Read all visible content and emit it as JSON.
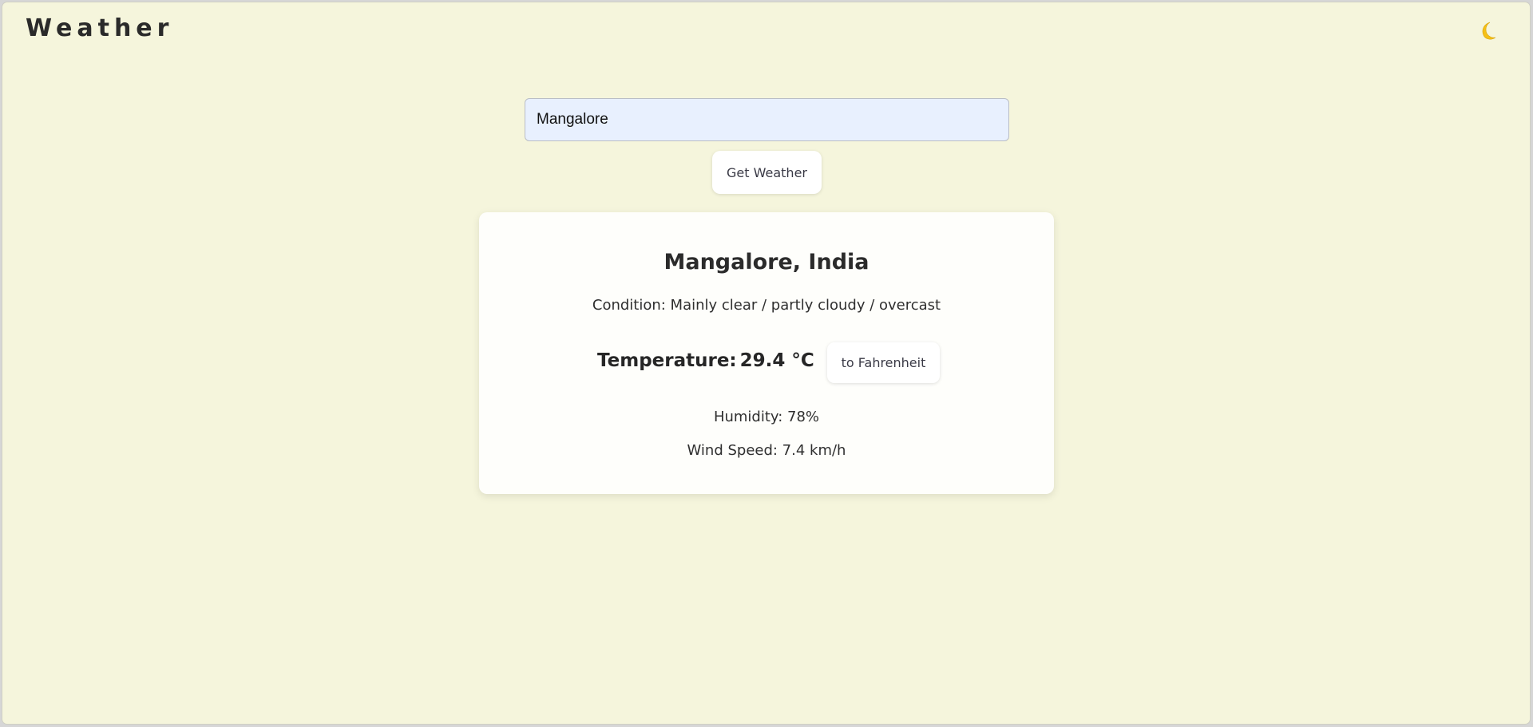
{
  "header": {
    "title": "Weather",
    "theme_toggle_icon": "moon-icon"
  },
  "search": {
    "value": "Mangalore",
    "button_label": "Get Weather"
  },
  "weather": {
    "location": "Mangalore, India",
    "condition": "Condition: Mainly clear / partly cloudy / overcast",
    "temperature_label": "Temperature:",
    "temperature_value": "29.4 °C",
    "unit_toggle_label": "to Fahrenheit",
    "humidity": "Humidity: 78%",
    "wind_speed": "Wind Speed: 7.4 km/h"
  },
  "colors": {
    "background": "#f5f5dc",
    "card": "#fefefb",
    "input_background": "#e8f0fe",
    "moon": "#f5c016"
  }
}
